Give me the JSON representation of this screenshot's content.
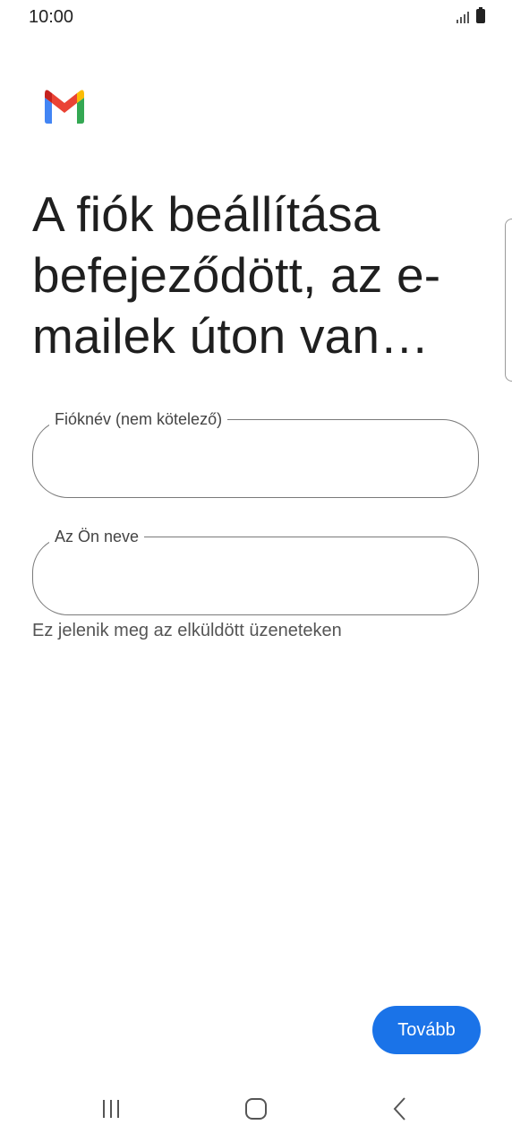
{
  "status_bar": {
    "time": "10:00",
    "icons": [
      "signal-icon",
      "battery-icon"
    ]
  },
  "app": {
    "logo": "gmail-logo",
    "colors": {
      "brand_red": "#EA4335",
      "brand_blue": "#4285F4",
      "brand_green": "#34A853",
      "brand_yellow": "#FBBC04",
      "primary_button": "#1A73E8"
    }
  },
  "page": {
    "title": "A fiók beállítása befejeződött, az e-mailek úton van…"
  },
  "form": {
    "account_name": {
      "label": "Fióknév (nem kötelező)",
      "value": ""
    },
    "your_name": {
      "label": "Az Ön neve",
      "value": "",
      "helper": "Ez jelenik meg az elküldött üzeneteken"
    }
  },
  "actions": {
    "next_label": "Tovább"
  },
  "nav_bar": {
    "icons": [
      "recents-icon",
      "home-icon",
      "back-icon"
    ]
  }
}
